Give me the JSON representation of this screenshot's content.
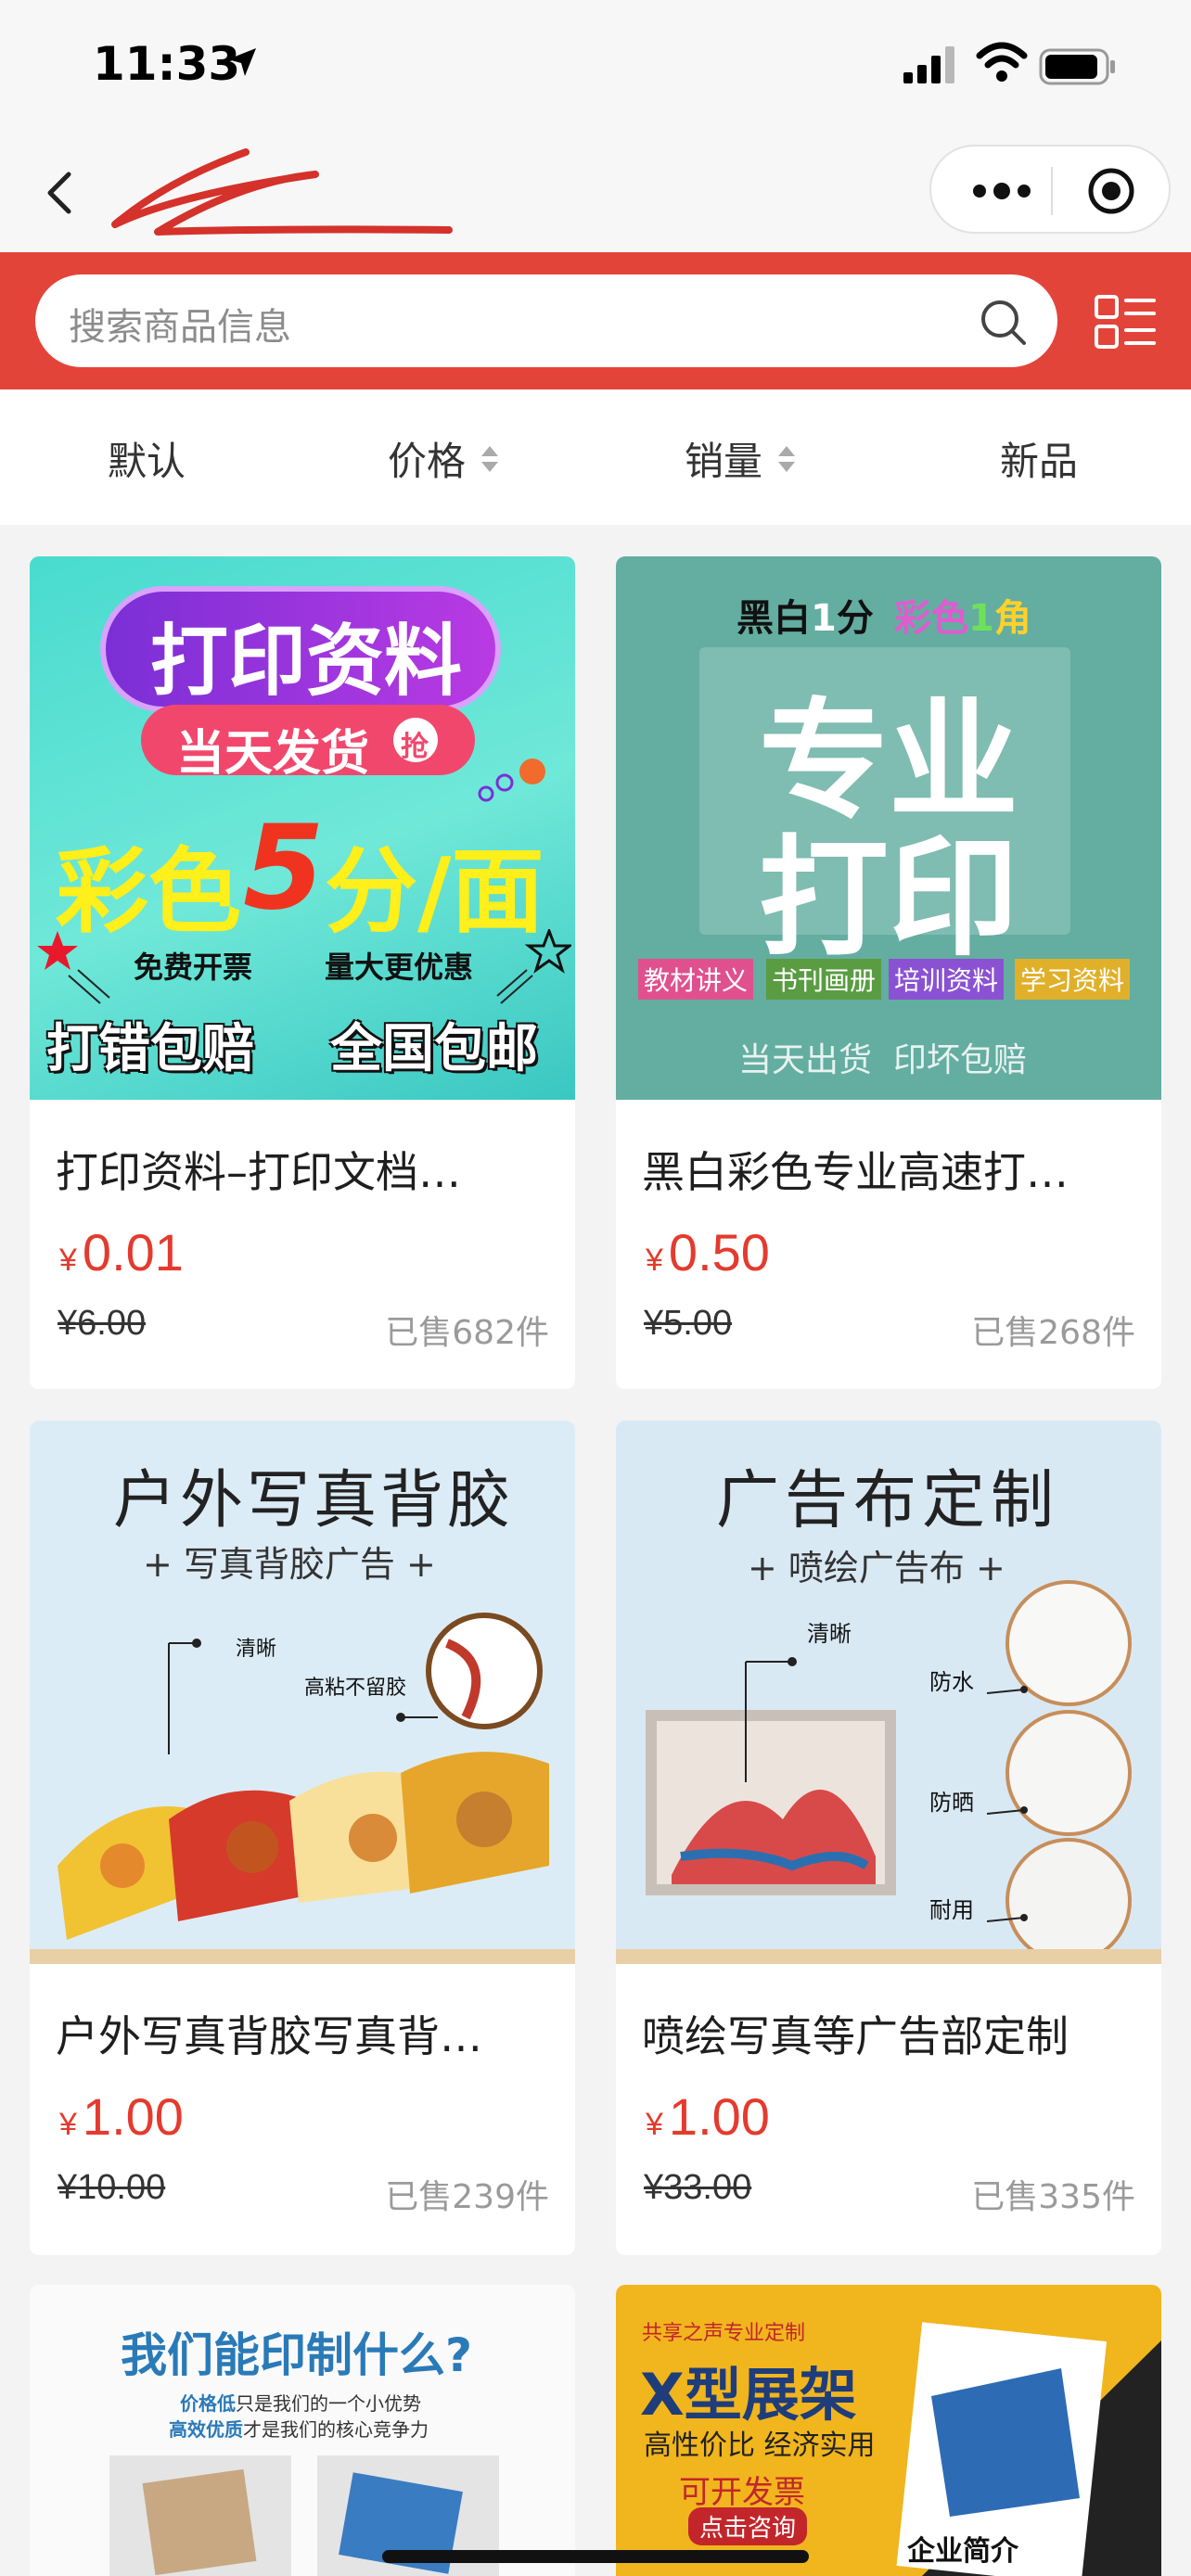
{
  "status_bar": {
    "time": "11:33"
  },
  "nav": {},
  "search": {
    "placeholder": "搜索商品信息"
  },
  "sort_tabs": [
    {
      "label": "默认"
    },
    {
      "label": "价格"
    },
    {
      "label": "销量"
    },
    {
      "label": "新品"
    }
  ],
  "products": [
    {
      "title": "打印资料–打印文档…",
      "currency": "¥",
      "price": "0.01",
      "original_price": "¥6.00",
      "sold": "已售682件",
      "image_text": {
        "headline": "打印资料",
        "ribbon": "当天发货",
        "badge": "抢",
        "big_pre": "彩色",
        "big_num": "5",
        "big_post": "分/面",
        "left_tag": "免费开票",
        "right_tag": "量大更优惠",
        "bottom_left": "打错包赔",
        "bottom_right": "全国包邮"
      }
    },
    {
      "title": "黑白彩色专业高速打…",
      "currency": "¥",
      "price": "0.50",
      "original_price": "¥5.00",
      "sold": "已售268件",
      "image_text": {
        "top_a": "黑白",
        "top_a_num": "1",
        "top_a_unit": "分",
        "top_b": "彩色",
        "top_b_num": "1",
        "top_b_unit": "角",
        "big_line1": "专业",
        "big_line2": "打印",
        "chips": [
          "教材讲义",
          "书刊画册",
          "培训资料",
          "学习资料"
        ],
        "footer": "当天出货  印坏包赔"
      }
    },
    {
      "title": "户外写真背胶写真背…",
      "currency": "¥",
      "price": "1.00",
      "original_price": "¥10.00",
      "sold": "已售239件",
      "image_text": {
        "headline": "户外写真背胶",
        "sub": "+ 写真背胶广告 +",
        "label_a": "清晰",
        "label_b": "高粘不留胶"
      }
    },
    {
      "title": "喷绘写真等广告部定制",
      "currency": "¥",
      "price": "1.00",
      "original_price": "¥33.00",
      "sold": "已售335件",
      "image_text": {
        "headline": "广告布定制",
        "sub": "+ 喷绘广告布 +",
        "label_a": "清晰",
        "label_b": "防水",
        "label_c": "防晒",
        "label_d": "耐用"
      }
    },
    {
      "image_text": {
        "headline": "我们能印制什么?",
        "line1_hl": "价格低",
        "line1": "只是我们的一个小优势",
        "line2_hl": "高效优质",
        "line2": "才是我们的核心竞争力"
      }
    },
    {
      "image_text": {
        "top": "共享之声专业定制",
        "headline": "X型展架",
        "sub": "高性价比 经济实用",
        "cta1": "可开发票",
        "cta2": "点击咨询",
        "brochure": "企业简介"
      }
    }
  ],
  "colors": {
    "accent": "#e3443a",
    "price": "#e33b2e"
  }
}
